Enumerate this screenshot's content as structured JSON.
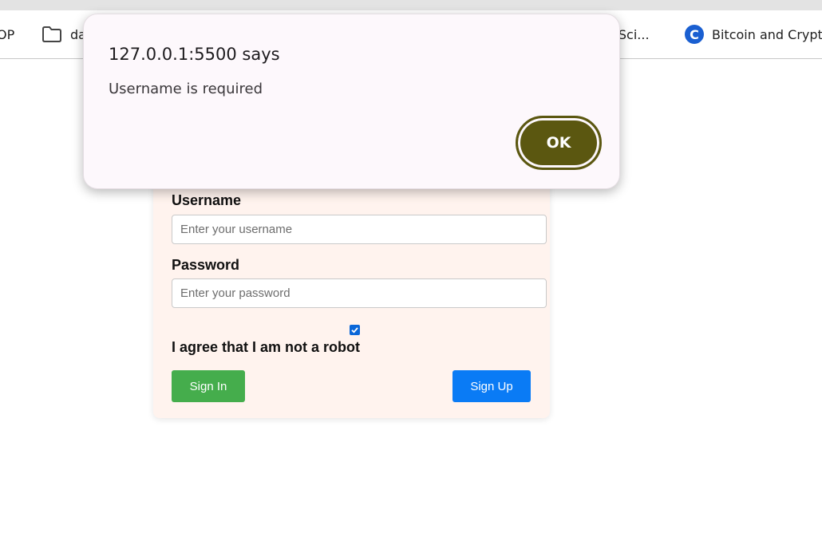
{
  "browser": {
    "bookmarks": [
      {
        "label": "OP",
        "icon": "none"
      },
      {
        "label": "da",
        "icon": "folder-icon"
      },
      {
        "label": "a Sci...",
        "icon": "none"
      },
      {
        "label": "Bitcoin and Crypto",
        "icon": "coingecko-icon"
      }
    ]
  },
  "login": {
    "username_label": "Username",
    "username_placeholder": "Enter your username",
    "password_label": "Password",
    "password_placeholder": "Enter your password",
    "robot_checked": true,
    "robot_label": "I agree that I am not a robot",
    "signin_label": "Sign In",
    "signup_label": "Sign Up",
    "colors": {
      "card_bg": "#fff3ee",
      "signin": "#45ad4c",
      "signup": "#0a7bf5"
    }
  },
  "alert": {
    "title": "127.0.0.1:5500 says",
    "message": "Username is required",
    "ok_label": "OK",
    "colors": {
      "ok_button": "#5b5710",
      "dialog_bg": "#fdf8fc"
    }
  }
}
